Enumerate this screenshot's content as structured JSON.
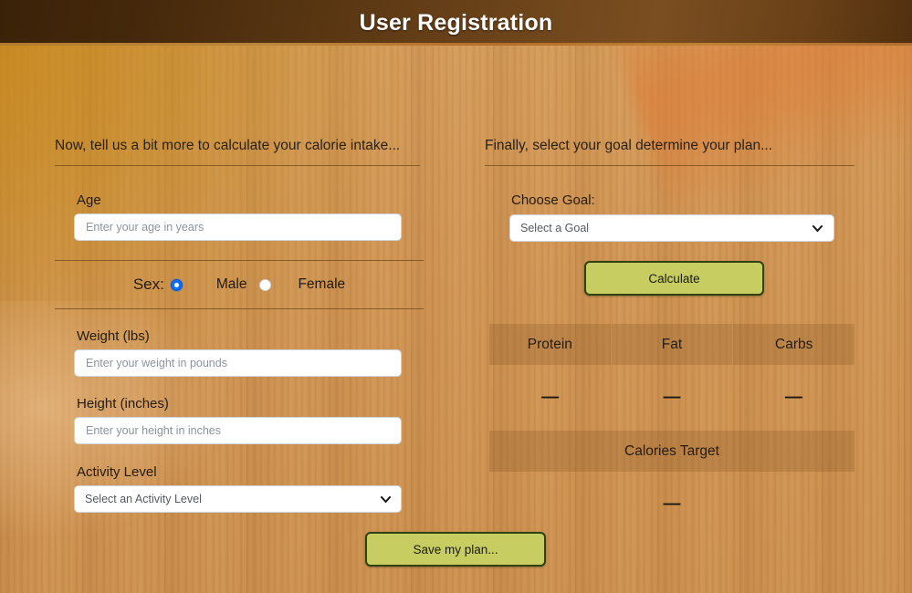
{
  "header": {
    "title": "User Registration"
  },
  "left": {
    "heading": "Now, tell us a bit more to calculate your calorie intake...",
    "age": {
      "label": "Age",
      "placeholder": "Enter your age in years",
      "value": ""
    },
    "sex": {
      "label": "Sex:",
      "options": [
        {
          "label": "Male",
          "checked": true
        },
        {
          "label": "Female",
          "checked": false
        }
      ]
    },
    "weight": {
      "label": "Weight (lbs)",
      "placeholder": "Enter your weight in pounds",
      "value": ""
    },
    "height": {
      "label": "Height (inches)",
      "placeholder": "Enter your height in inches",
      "value": ""
    },
    "activity": {
      "label": "Activity Level",
      "selected": "Select an Activity Level",
      "chevron_icon": "chevron-down-icon"
    }
  },
  "right": {
    "heading": "Finally, select your goal determine your plan...",
    "goal": {
      "label": "Choose Goal:",
      "selected": "Select a Goal",
      "chevron_icon": "chevron-down-icon"
    },
    "calculate_label": "Calculate",
    "macros": {
      "columns": [
        "Protein",
        "Fat",
        "Carbs"
      ],
      "values": [
        "—",
        "—",
        "—"
      ],
      "calories_label": "Calories Target",
      "calories_value": "—"
    }
  },
  "footer": {
    "save_label": "Save my plan..."
  },
  "colors": {
    "header_dark": "#3a2208",
    "header_light": "#7a4e20",
    "wood": "#cf9350",
    "button_fill": "#c8cd62",
    "button_border": "#2f4212",
    "radio_checked": "#0d6efd",
    "rule": "#7a5220"
  }
}
